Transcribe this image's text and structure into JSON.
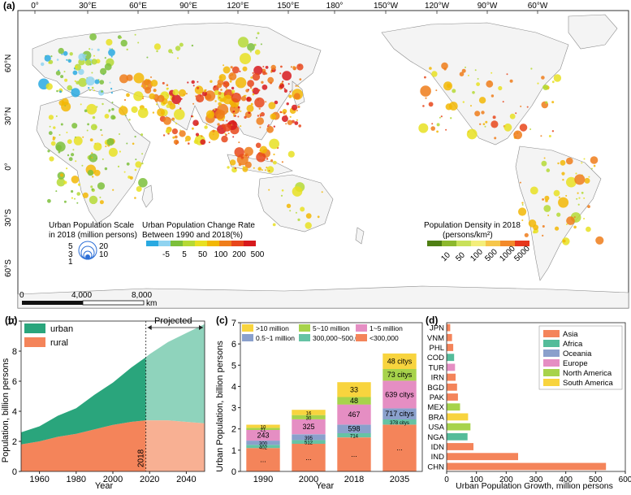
{
  "map": {
    "panel_label": "(a)",
    "top_lon_labels": [
      "0°",
      "30°E",
      "60°E",
      "90°E",
      "120°E",
      "150°E",
      "180°",
      "150°W",
      "120°W",
      "90°W",
      "60°W"
    ],
    "left_lat_labels": [
      "60°N",
      "30°N",
      "0°",
      "30°S",
      "60°S"
    ],
    "scale_legend": {
      "title_line1": "Urban Population Scale",
      "title_line2": "in 2018 (million persons)",
      "values": [
        "5",
        "3",
        "1",
        "20",
        "10"
      ]
    },
    "change_legend": {
      "title_line1": "Urban Population Change Rate",
      "title_line2": "Between 1990 and 2018(%)",
      "ticks": [
        "-5",
        "5",
        "50",
        "100",
        "200",
        "500"
      ],
      "colors": [
        "#29a9e1",
        "#8fd3f0",
        "#7cbf3b",
        "#b5d935",
        "#e8e022",
        "#f2b705",
        "#ef7d1a",
        "#e8461b",
        "#d7191c"
      ]
    },
    "density_legend": {
      "title_line1": "Population Density in 2018",
      "title_line2": "(persons/km²)",
      "ticks": [
        "10",
        "50",
        "100",
        "500",
        "1000",
        "5000"
      ],
      "colors": [
        "#4f7f14",
        "#8cb82d",
        "#c9e15a",
        "#f4ee7a",
        "#f6c64a",
        "#f38a2a",
        "#e6361c"
      ]
    },
    "scalebar": {
      "labels": [
        "0",
        "4,000",
        "8,000"
      ],
      "unit": "km"
    },
    "colors": {
      "land": "#f4f4f4",
      "ocean": "#ffffff",
      "border": "#8a8a8a"
    }
  },
  "panel_b": {
    "panel_label": "(b)",
    "legend": [
      "urban",
      "rural"
    ],
    "projected_label": "Projected",
    "vline_label": "2018",
    "colors": {
      "urban": "#2aa57c",
      "urban_projected": "#8fd3bc",
      "rural": "#f4845a",
      "rural_projected": "#f8b093"
    }
  },
  "panel_c": {
    "panel_label": "(c)",
    "legend": [
      ">10 million",
      "5~10 million",
      "1~5 million",
      "0.5~1 million",
      "300,000~500,000",
      "<300,000"
    ],
    "colors": [
      "#f8d43e",
      "#a7d34b",
      "#e58ec3",
      "#8aa0cc",
      "#65c3a4",
      "#f4845a"
    ]
  },
  "panel_d": {
    "panel_label": "(d)",
    "legend": [
      "Asia",
      "Africa",
      "Oceania",
      "Europe",
      "North America",
      "South America"
    ],
    "colors": {
      "Asia": "#f4845a",
      "Africa": "#54bc9a",
      "Oceania": "#8aa0cc",
      "Europe": "#e58ec3",
      "North America": "#a7d34b",
      "South America": "#f8d43e"
    }
  },
  "chart_data": [
    {
      "type": "area",
      "x": [
        1950,
        1960,
        1970,
        1980,
        1990,
        2000,
        2010,
        2018,
        2020,
        2030,
        2040,
        2050
      ],
      "series": [
        {
          "name": "rural",
          "values": [
            1.8,
            2.0,
            2.3,
            2.5,
            2.8,
            3.1,
            3.3,
            3.4,
            3.4,
            3.4,
            3.3,
            3.2
          ]
        },
        {
          "name": "urban",
          "values": [
            0.8,
            1.0,
            1.4,
            1.7,
            2.3,
            2.8,
            3.6,
            4.2,
            4.4,
            5.2,
            5.9,
            6.6
          ]
        }
      ],
      "stacked": true,
      "xlabel": "Year",
      "ylabel": "Population, billion persons",
      "xlim": [
        1950,
        2050
      ],
      "ylim": [
        0,
        10
      ],
      "xticks": [
        1960,
        1980,
        2000,
        2020,
        2040
      ],
      "yticks": [
        0,
        2,
        4,
        6,
        8,
        10
      ],
      "grid": false,
      "legend_position": "top-left"
    },
    {
      "type": "bar",
      "categories": [
        "1990",
        "2000",
        "2018",
        "2035"
      ],
      "stacked": true,
      "series": [
        {
          "name": "<300,000",
          "values": [
            1.1,
            1.3,
            1.6,
            2.2
          ],
          "labels": [
            "...",
            "...",
            "...",
            "..."
          ]
        },
        {
          "name": "300,000~500,000",
          "values": [
            0.15,
            0.18,
            0.2,
            0.25
          ],
          "labels": [
            "402",
            "512",
            "714",
            "378 citys"
          ]
        },
        {
          "name": "0.5~1 million",
          "values": [
            0.2,
            0.27,
            0.4,
            0.52
          ],
          "labels": [
            "300",
            "395",
            "598",
            "717 citys"
          ]
        },
        {
          "name": "1~5 million",
          "values": [
            0.5,
            0.7,
            0.95,
            1.3
          ],
          "labels": [
            "243",
            "325",
            "467",
            "639 citys"
          ]
        },
        {
          "name": "5~10 million",
          "values": [
            0.1,
            0.2,
            0.35,
            0.55
          ],
          "labels": [
            "21",
            "30",
            "48",
            "73 citys"
          ]
        },
        {
          "name": ">10 million",
          "values": [
            0.15,
            0.25,
            0.7,
            0.73
          ],
          "labels": [
            "10",
            "16",
            "33",
            "48 citys"
          ]
        }
      ],
      "xlabel": "Year",
      "ylabel": "Urban Population, billion persons",
      "ylim": [
        0,
        7
      ],
      "yticks": [
        0,
        1,
        2,
        3,
        4,
        5,
        6,
        7
      ],
      "grid": false,
      "legend_position": "top"
    },
    {
      "type": "bar",
      "orientation": "horizontal",
      "categories": [
        "CHN",
        "IND",
        "IDN",
        "NGA",
        "USA",
        "BRA",
        "MEX",
        "PAK",
        "BGD",
        "IRN",
        "TUR",
        "COD",
        "PHL",
        "VNM",
        "JPN"
      ],
      "values": [
        535,
        240,
        90,
        70,
        80,
        72,
        45,
        38,
        35,
        30,
        28,
        25,
        22,
        18,
        12
      ],
      "groups": [
        "Asia",
        "Asia",
        "Asia",
        "Africa",
        "North America",
        "South America",
        "North America",
        "Asia",
        "Asia",
        "Asia",
        "Europe",
        "Africa",
        "Asia",
        "Asia",
        "Asia"
      ],
      "xlabel": "Urban Population Growth, million persons",
      "xlim": [
        0,
        600
      ],
      "xticks": [
        0,
        100,
        200,
        300,
        400,
        500,
        600
      ],
      "grid": false,
      "legend_position": "top-right"
    }
  ]
}
